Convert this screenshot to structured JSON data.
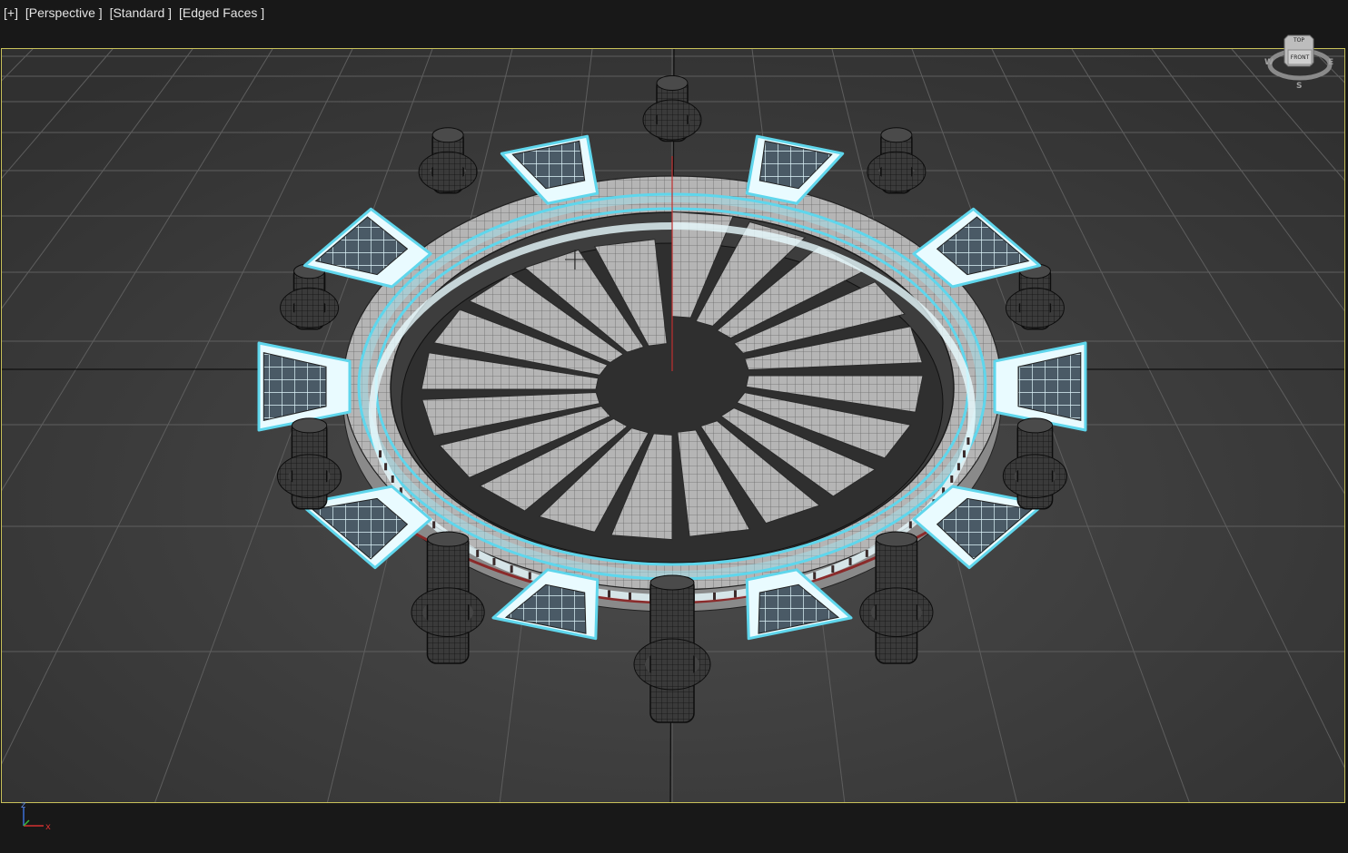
{
  "viewport": {
    "labels": {
      "plus": "[+]",
      "view": "[Perspective ]",
      "shading": "[Standard ]",
      "display": "[Edged Faces ]"
    },
    "type": "Perspective",
    "border_color": "#c9c15a",
    "background_color": "#424242"
  },
  "viewcube": {
    "top_face": "TOP",
    "front_face": "FRONT",
    "compass": {
      "w": "W",
      "e": "E",
      "s": "S"
    }
  },
  "axis_tripod": {
    "x": "x",
    "y": "y",
    "z": "z"
  },
  "scene": {
    "selection_color": "#5fd6ec",
    "mesh_color": "#a8a8a8",
    "wire_color": "#1a1a1a",
    "object_count_pillars": 10,
    "object_count_tabs": 10,
    "step_count": 20
  }
}
